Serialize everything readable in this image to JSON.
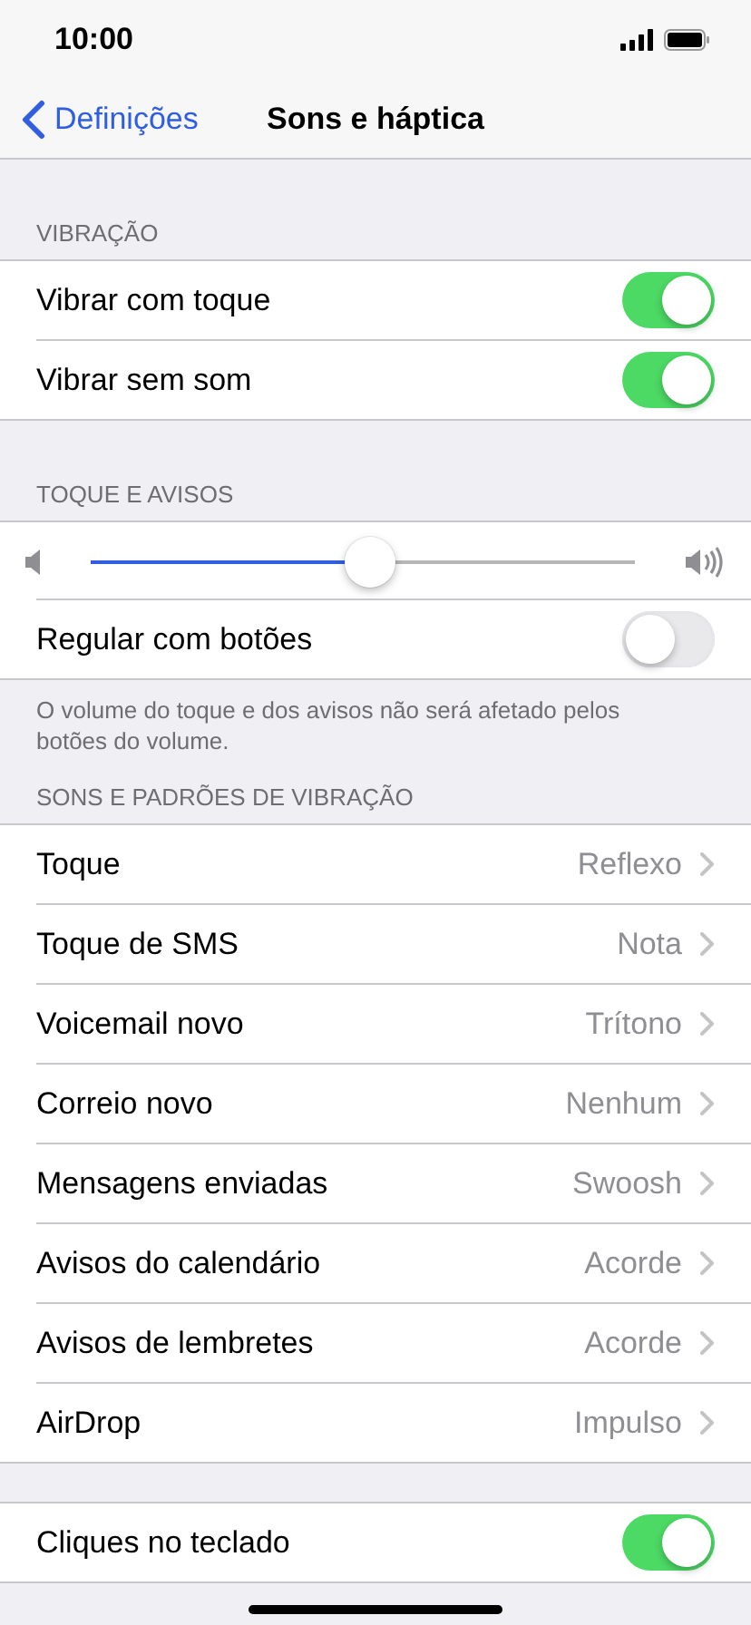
{
  "status_bar": {
    "time": "10:00"
  },
  "nav": {
    "back": "Definições",
    "title": "Sons e háptica"
  },
  "sections": [
    {
      "header": "VIBRAÇÃO",
      "rows": [
        {
          "kind": "toggle",
          "label": "Vibrar com toque",
          "on": true
        },
        {
          "kind": "toggle",
          "label": "Vibrar sem som",
          "on": true
        }
      ]
    },
    {
      "header": "TOQUE E AVISOS",
      "rows": [
        {
          "kind": "slider",
          "level": 0.47
        },
        {
          "kind": "toggle",
          "label": "Regular com botões",
          "on": false
        }
      ],
      "footer": "O volume do toque e dos avisos não será afetado pelos botões do volume."
    },
    {
      "header": "SONS E PADRÕES DE VIBRAÇÃO",
      "rows": [
        {
          "kind": "link",
          "label": "Toque",
          "value": "Reflexo"
        },
        {
          "kind": "link",
          "label": "Toque de SMS",
          "value": "Nota"
        },
        {
          "kind": "link",
          "label": "Voicemail novo",
          "value": "Trítono"
        },
        {
          "kind": "link",
          "label": "Correio novo",
          "value": "Nenhum"
        },
        {
          "kind": "link",
          "label": "Mensagens enviadas",
          "value": "Swoosh"
        },
        {
          "kind": "link",
          "label": "Avisos do calendário",
          "value": "Acorde"
        },
        {
          "kind": "link",
          "label": "Avisos de lembretes",
          "value": "Acorde"
        },
        {
          "kind": "link",
          "label": "AirDrop",
          "value": "Impulso"
        }
      ]
    },
    {
      "rows": [
        {
          "kind": "toggle",
          "label": "Cliques no teclado",
          "on": true
        }
      ]
    }
  ]
}
